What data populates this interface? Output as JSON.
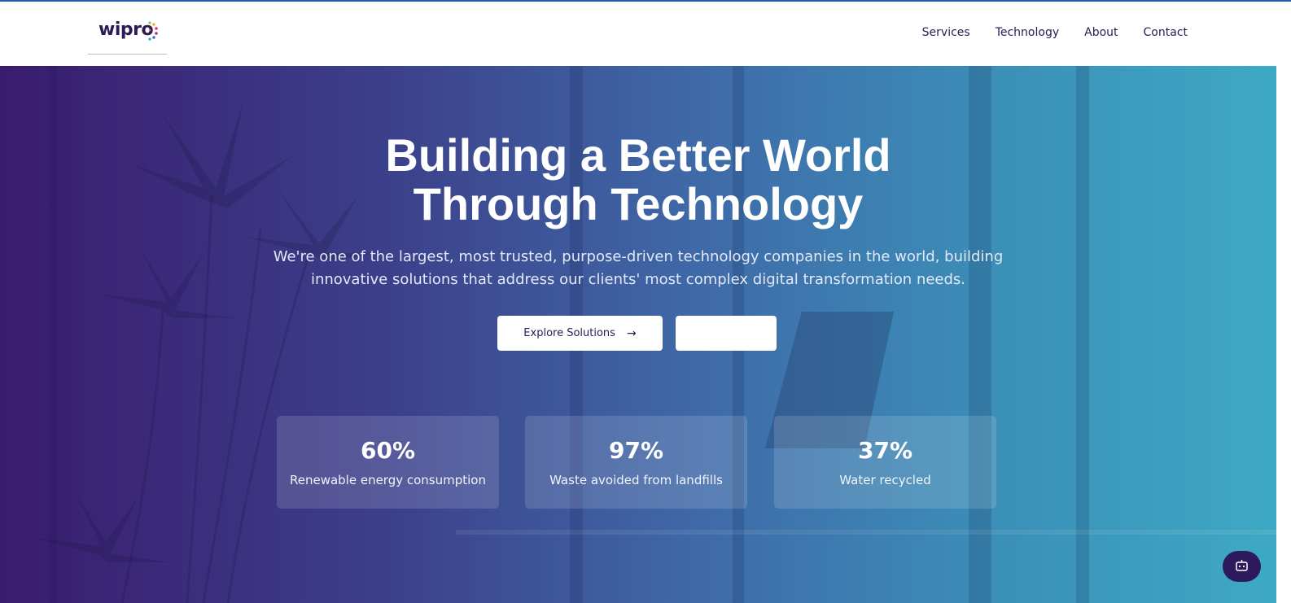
{
  "header": {
    "logo_text": "wipro",
    "nav": [
      "Services",
      "Technology",
      "About",
      "Contact"
    ]
  },
  "hero": {
    "title_line1": "Building a Better World",
    "title_line2": "Through Technology",
    "subtitle_line1": "We're one of the largest, most trusted, purpose-driven technology companies in the world, building",
    "subtitle_line2": "innovative solutions that address our clients' most complex digital transformation needs.",
    "primary_button": "Explore Solutions",
    "primary_button_icon": "arrow-right-icon",
    "secondary_button": ""
  },
  "stats": [
    {
      "value": "60%",
      "label": "Renewable energy consumption"
    },
    {
      "value": "97%",
      "label": "Waste avoided from landfills"
    },
    {
      "value": "37%",
      "label": "Water recycled"
    }
  ],
  "chat_widget_icon": "chat-bot-icon",
  "colors": {
    "brand_dark": "#2b1a55",
    "gradient_start": "#3a1c6e",
    "gradient_end": "#3ea9c4",
    "accent_bar": "#1f5fa8"
  }
}
